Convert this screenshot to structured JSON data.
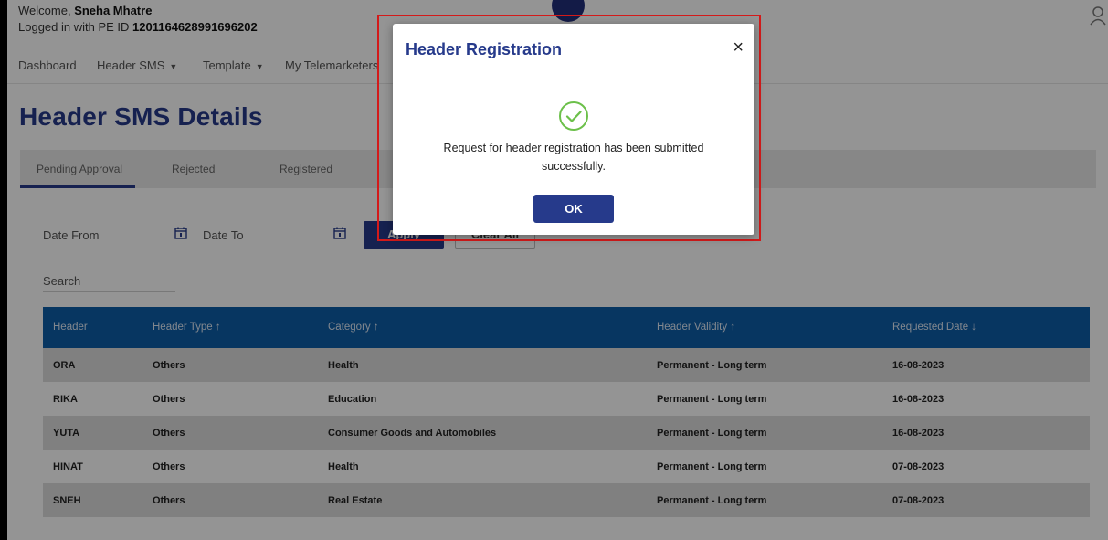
{
  "header": {
    "welcome_prefix": "Welcome,",
    "user_name": "Sneha Mhatre",
    "pe_prefix": "Logged in with PE ID",
    "pe_id": "1201164628991696202"
  },
  "nav": {
    "items": [
      {
        "label": "Dashboard",
        "dropdown": false
      },
      {
        "label": "Header SMS",
        "dropdown": true
      },
      {
        "label": "Template",
        "dropdown": true
      },
      {
        "label": "My Telemarketers",
        "dropdown": false
      }
    ]
  },
  "page": {
    "title": "Header SMS Details"
  },
  "tabs": [
    {
      "label": "Pending Approval",
      "active": true
    },
    {
      "label": "Rejected",
      "active": false
    },
    {
      "label": "Registered",
      "active": false
    }
  ],
  "filters": {
    "date_from_label": "Date From",
    "date_to_label": "Date To",
    "apply_label": "Apply",
    "clear_label": "Clear All",
    "search_label": "Search"
  },
  "table": {
    "columns": [
      "Header",
      "Header Type ↑",
      "Category ↑",
      "Header Validity ↑",
      "Requested Date ↓"
    ],
    "rows": [
      [
        "ORA",
        "Others",
        "Health",
        "Permanent - Long term",
        "16-08-2023"
      ],
      [
        "RIKA",
        "Others",
        "Education",
        "Permanent - Long term",
        "16-08-2023"
      ],
      [
        "YUTA",
        "Others",
        "Consumer Goods and Automobiles",
        "Permanent - Long term",
        "16-08-2023"
      ],
      [
        "HINAT",
        "Others",
        "Health",
        "Permanent - Long term",
        "07-08-2023"
      ],
      [
        "SNEH",
        "Others",
        "Real Estate",
        "Permanent - Long term",
        "07-08-2023"
      ]
    ]
  },
  "modal": {
    "title": "Header Registration",
    "close": "×",
    "message": "Request for header registration has been submitted successfully.",
    "ok_label": "OK"
  },
  "colors": {
    "brand": "#263a8b",
    "table_header": "#0d5ea8",
    "success": "#6cc04a",
    "highlight": "#d31a1a"
  }
}
